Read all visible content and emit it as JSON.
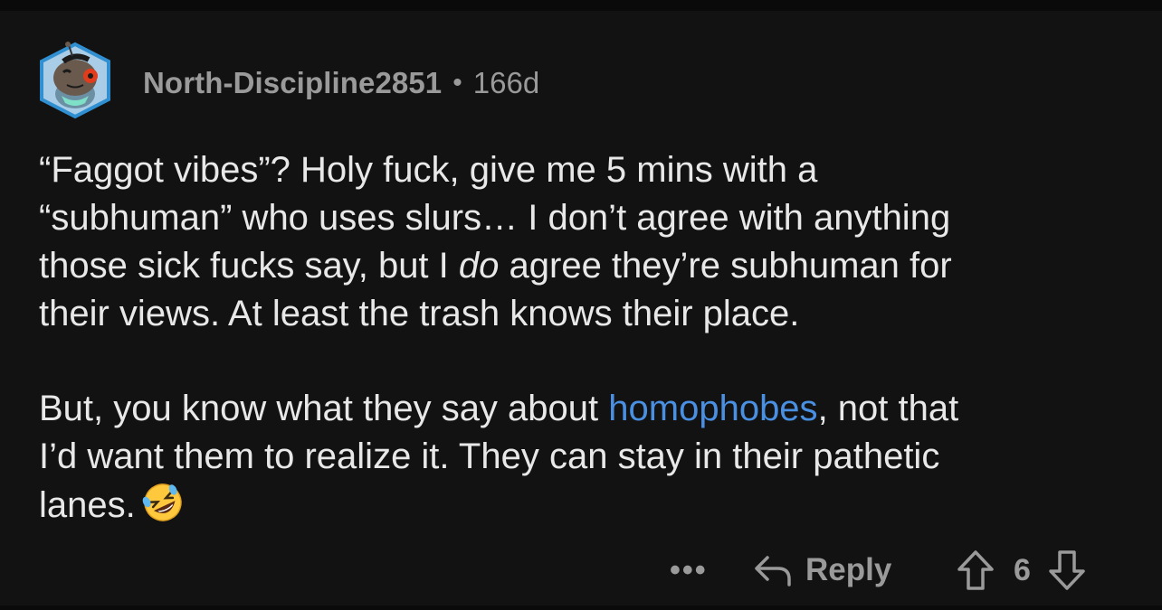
{
  "comment": {
    "author": "North-Discipline2851",
    "separator": "•",
    "age": "166d",
    "paragraph1_line1": "“Faggot vibes”? Holy fuck, give me 5 mins with a",
    "paragraph1_line2": "“subhuman” who uses slurs… I don’t agree with anything",
    "paragraph1_line3a": "those sick fucks say, but I ",
    "paragraph1_line3_italic": "do",
    "paragraph1_line3b": " agree they’re subhuman for",
    "paragraph1_line4": "their views. At least the trash knows their place.",
    "paragraph2_before_link": "But, you know what they say about ",
    "paragraph2_link": "homophobes",
    "paragraph2_after_link": ", not that",
    "paragraph2_line2": "I’d want them to realize it. They can stay in their pathetic",
    "paragraph2_line3": "lanes.",
    "emoji_icon": "rolling-on-floor-laughing-emoji"
  },
  "actions": {
    "more_label": "•••",
    "reply_label": "Reply",
    "vote_count": "6"
  },
  "colors": {
    "background": "#121212",
    "text": "#e8e8e8",
    "muted": "#9a9a9a",
    "link": "#4a90e2"
  }
}
